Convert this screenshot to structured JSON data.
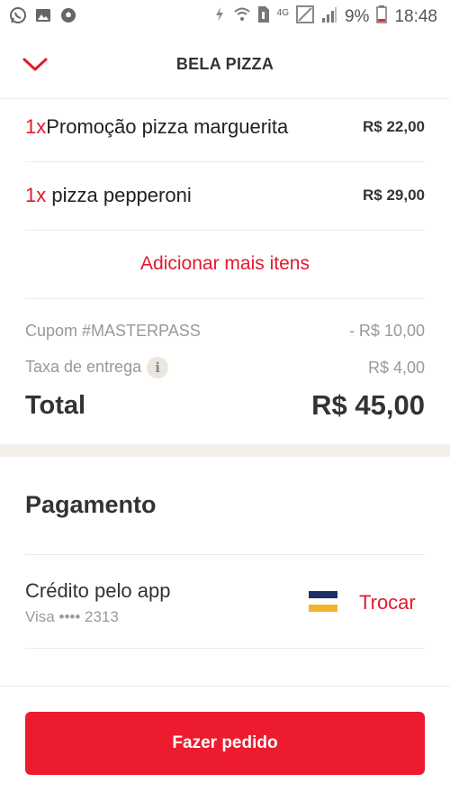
{
  "status_bar": {
    "left_icons": [
      "whatsapp-icon",
      "image-icon",
      "soccer-ball-icon"
    ],
    "network": "4G",
    "battery": "9%",
    "time": "18:48"
  },
  "header": {
    "title": "BELA PIZZA"
  },
  "cart": {
    "items": [
      {
        "qty": "1x",
        "name": "Promoção pizza marguerita",
        "price": "R$ 22,00"
      },
      {
        "qty": "1x",
        "name": "pizza pepperoni",
        "price": "R$ 29,00"
      }
    ],
    "add_more": "Adicionar mais itens"
  },
  "summary": {
    "coupon_label": "Cupom #MASTERPASS",
    "coupon_value": "- R$ 10,00",
    "delivery_label": "Taxa de entrega",
    "delivery_value": "R$ 4,00",
    "info_glyph": "i",
    "total_label": "Total",
    "total_value": "R$ 45,00"
  },
  "payment": {
    "title": "Pagamento",
    "method_name": "Crédito pelo app",
    "method_detail": "Visa •••• 2313",
    "change_label": "Trocar"
  },
  "cta": {
    "label": "Fazer pedido"
  },
  "colors": {
    "accent": "#e3192d",
    "button": "#ec1b2e",
    "card_blue": "#1f2f64",
    "card_yellow": "#f3b52a"
  }
}
